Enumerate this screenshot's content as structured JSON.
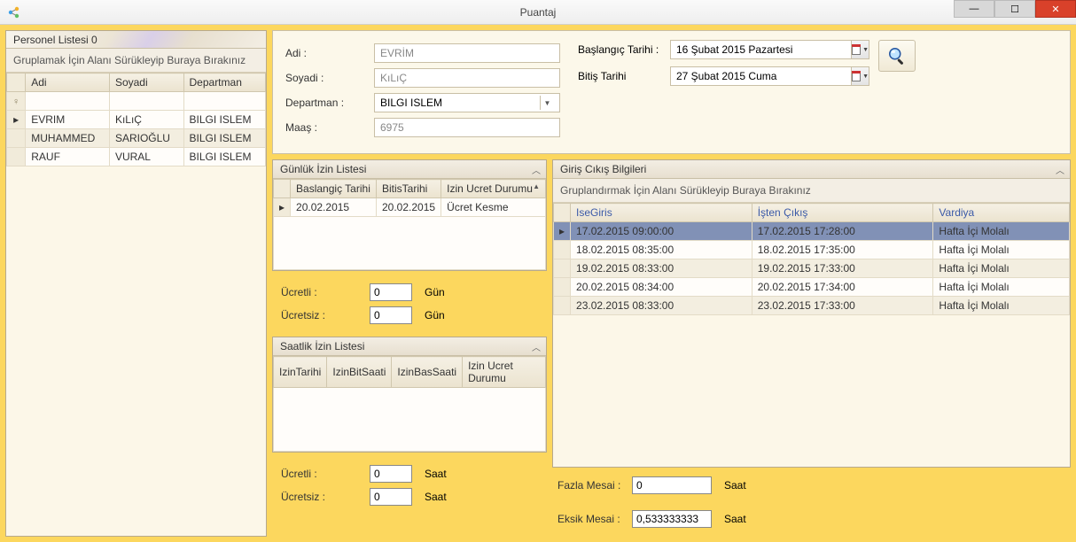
{
  "titlebar": {
    "title": "Puantaj"
  },
  "personnel": {
    "header": "Personel Listesi   0",
    "group_hint": "Gruplamak İçin Alanı Sürükleyip Buraya Bırakınız",
    "columns": {
      "adi": "Adi",
      "soyadi": "Soyadi",
      "departman": "Departman"
    },
    "rows": [
      {
        "adi": "EVRIM",
        "soyadi": "KıLıÇ",
        "departman": "BILGI ISLEM",
        "selected": true
      },
      {
        "adi": "MUHAMMED",
        "soyadi": "SARIOĞLU",
        "departman": "BILGI ISLEM"
      },
      {
        "adi": "RAUF",
        "soyadi": "VURAL",
        "departman": "BILGI ISLEM"
      }
    ]
  },
  "form": {
    "labels": {
      "adi": "Adi :",
      "soyadi": "Soyadi :",
      "departman": "Departman :",
      "maas": "Maaş :"
    },
    "values": {
      "adi": "EVRİM",
      "soyadi": "KıLıÇ",
      "departman": "BILGI ISLEM",
      "maas": "6975"
    }
  },
  "dates": {
    "start_label": "Başlangıç Tarihi :",
    "end_label": "Bitiş Tarihi",
    "start": "16   Şubat   2015   Pazartesi",
    "end": "27   Şubat   2015   Cuma"
  },
  "daily_leave": {
    "header": "Günlük İzin Listesi",
    "columns": {
      "start": "Baslangiç Tarihi",
      "end": "BitisTarihi",
      "status": "Izin Ucret Durumu"
    },
    "rows": [
      {
        "start": "20.02.2015",
        "end": "20.02.2015",
        "status": "Ücret Kesme"
      }
    ],
    "summary": {
      "ucretli_label": "Ücretli :",
      "ucretli_value": "0",
      "ucretli_unit": "Gün",
      "ucretsiz_label": "Ücretsiz :",
      "ucretsiz_value": "0",
      "ucretsiz_unit": "Gün"
    }
  },
  "hourly_leave": {
    "header": "Saatlik İzin Listesi",
    "columns": {
      "date": "IzinTarihi",
      "end": "IzinBitSaati",
      "start": "IzinBasSaati",
      "status": "Izin Ucret Durumu"
    },
    "summary": {
      "ucretli_label": "Ücretli :",
      "ucretli_value": "0",
      "ucretli_unit": "Saat",
      "ucretsiz_label": "Ücretsiz :",
      "ucretsiz_value": "0",
      "ucretsiz_unit": "Saat"
    }
  },
  "inout": {
    "header": "Giriş Cıkış Bilgileri",
    "group_hint": "Gruplandırmak İçin Alanı Sürükleyip Buraya Bırakınız",
    "columns": {
      "in": "IseGiris",
      "out": "İşten Çıkış",
      "shift": "Vardiya"
    },
    "rows": [
      {
        "in": "17.02.2015 09:00:00",
        "out": "17.02.2015 17:28:00",
        "shift": "Hafta İçi Molalı",
        "selected": true
      },
      {
        "in": "18.02.2015 08:35:00",
        "out": "18.02.2015 17:35:00",
        "shift": "Hafta İçi Molalı"
      },
      {
        "in": "19.02.2015 08:33:00",
        "out": "19.02.2015 17:33:00",
        "shift": "Hafta İçi Molalı"
      },
      {
        "in": "20.02.2015 08:34:00",
        "out": "20.02.2015 17:34:00",
        "shift": "Hafta İçi Molalı"
      },
      {
        "in": "23.02.2015 08:33:00",
        "out": "23.02.2015 17:33:00",
        "shift": "Hafta İçi Molalı"
      }
    ]
  },
  "overtime": {
    "fazla_label": "Fazla Mesai  :",
    "fazla_value": "0",
    "fazla_unit": "Saat",
    "eksik_label": "Eksik Mesai  :",
    "eksik_value": "0,533333333",
    "eksik_unit": "Saat"
  }
}
